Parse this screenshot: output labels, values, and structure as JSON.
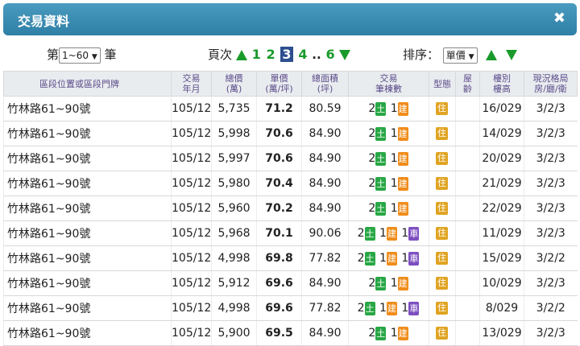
{
  "window": {
    "title": "交易資料",
    "close_glyph": "✖"
  },
  "controls": {
    "range_prefix": "第",
    "range_value": "1~60",
    "range_suffix": "筆",
    "page_label": "頁次",
    "pages": [
      "1",
      "2",
      "3",
      "4"
    ],
    "current_page": "3",
    "ellipsis": "..",
    "last_page": "6",
    "sort_label": "排序：",
    "sort_value": "單價"
  },
  "table": {
    "headers": {
      "location": "區段位置或區段門牌",
      "date_1": "交易",
      "date_2": "年月",
      "total_1": "總價",
      "total_2": "(萬)",
      "unit_1": "單價",
      "unit_2": "(萬/坪)",
      "area_1": "總面積",
      "area_2": "(坪)",
      "txn_1": "交易",
      "txn_2": "筆棟數",
      "type": "型態",
      "age_1": "屋",
      "age_2": "齡",
      "floor_1": "樓別",
      "floor_2": "樓高",
      "layout_1": "現況格局",
      "layout_2": "房/廳/衛"
    },
    "tags": {
      "land": "土",
      "building": "建",
      "car": "車",
      "residence": "住"
    },
    "rows": [
      {
        "location": "竹林路61~90號",
        "date": "105/12",
        "total": "5,735",
        "unit": "71.2",
        "area": "80.59",
        "land": "2",
        "building": "1",
        "car": "",
        "type": "住",
        "age": "",
        "floor": "16/029",
        "layout": "3/2/3"
      },
      {
        "location": "竹林路61~90號",
        "date": "105/12",
        "total": "5,998",
        "unit": "70.6",
        "area": "84.90",
        "land": "2",
        "building": "1",
        "car": "",
        "type": "住",
        "age": "",
        "floor": "14/029",
        "layout": "3/2/3"
      },
      {
        "location": "竹林路61~90號",
        "date": "105/12",
        "total": "5,997",
        "unit": "70.6",
        "area": "84.90",
        "land": "2",
        "building": "1",
        "car": "",
        "type": "住",
        "age": "",
        "floor": "20/029",
        "layout": "3/2/3"
      },
      {
        "location": "竹林路61~90號",
        "date": "105/12",
        "total": "5,980",
        "unit": "70.4",
        "area": "84.90",
        "land": "2",
        "building": "1",
        "car": "",
        "type": "住",
        "age": "",
        "floor": "21/029",
        "layout": "3/2/3"
      },
      {
        "location": "竹林路61~90號",
        "date": "105/12",
        "total": "5,960",
        "unit": "70.2",
        "area": "84.90",
        "land": "2",
        "building": "1",
        "car": "",
        "type": "住",
        "age": "",
        "floor": "22/029",
        "layout": "3/2/3"
      },
      {
        "location": "竹林路61~90號",
        "date": "105/12",
        "total": "5,968",
        "unit": "70.1",
        "area": "90.06",
        "land": "2",
        "building": "1",
        "car": "1",
        "type": "住",
        "age": "",
        "floor": "11/029",
        "layout": "3/2/3"
      },
      {
        "location": "竹林路61~90號",
        "date": "105/12",
        "total": "4,998",
        "unit": "69.8",
        "area": "77.82",
        "land": "2",
        "building": "1",
        "car": "1",
        "type": "住",
        "age": "",
        "floor": "15/029",
        "layout": "3/2/2"
      },
      {
        "location": "竹林路61~90號",
        "date": "105/12",
        "total": "5,912",
        "unit": "69.6",
        "area": "84.90",
        "land": "2",
        "building": "1",
        "car": "",
        "type": "住",
        "age": "",
        "floor": "10/029",
        "layout": "3/2/3"
      },
      {
        "location": "竹林路61~90號",
        "date": "105/12",
        "total": "4,998",
        "unit": "69.6",
        "area": "77.82",
        "land": "2",
        "building": "1",
        "car": "1",
        "type": "住",
        "age": "",
        "floor": "8/029",
        "layout": "3/2/2"
      },
      {
        "location": "竹林路61~90號",
        "date": "105/12",
        "total": "5,900",
        "unit": "69.5",
        "area": "84.90",
        "land": "2",
        "building": "1",
        "car": "",
        "type": "住",
        "age": "",
        "floor": "13/029",
        "layout": "3/2/3"
      }
    ]
  }
}
